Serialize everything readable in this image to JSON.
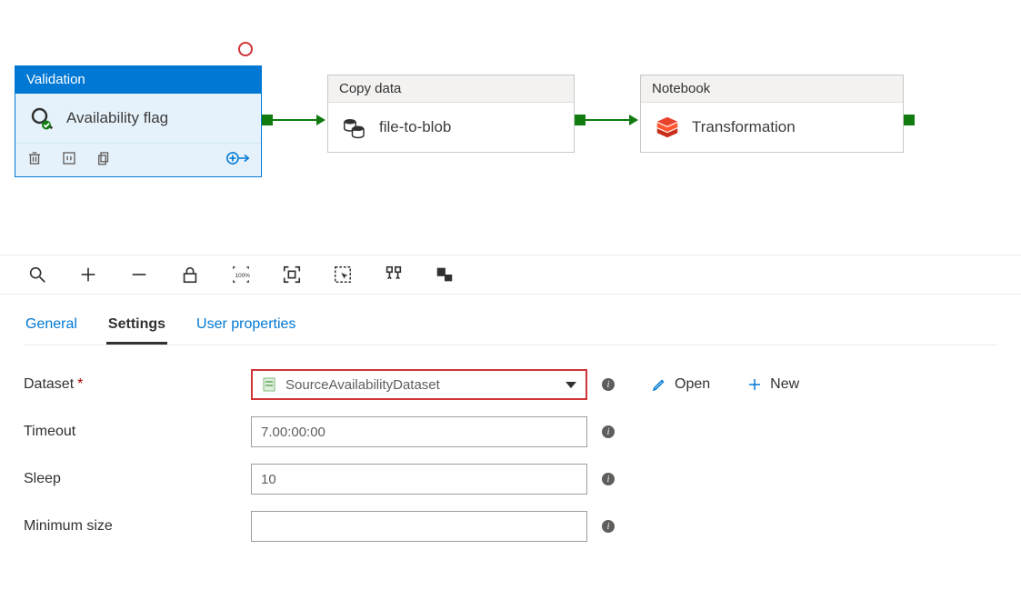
{
  "pipeline": {
    "activities": [
      {
        "type_label": "Validation",
        "name": "Availability flag",
        "selected": true,
        "icon": "search-validate"
      },
      {
        "type_label": "Copy data",
        "name": "file-to-blob",
        "selected": false,
        "icon": "database-copy"
      },
      {
        "type_label": "Notebook",
        "name": "Transformation",
        "selected": false,
        "icon": "databricks"
      }
    ]
  },
  "tabs": {
    "general": "General",
    "settings": "Settings",
    "user_properties": "User properties",
    "active": "settings"
  },
  "settings_form": {
    "dataset_label": "Dataset",
    "dataset_value": "SourceAvailabilityDataset",
    "timeout_label": "Timeout",
    "timeout_value": "7.00:00:00",
    "sleep_label": "Sleep",
    "sleep_value": "10",
    "min_size_label": "Minimum size",
    "min_size_value": "",
    "open_label": "Open",
    "new_label": "New"
  }
}
